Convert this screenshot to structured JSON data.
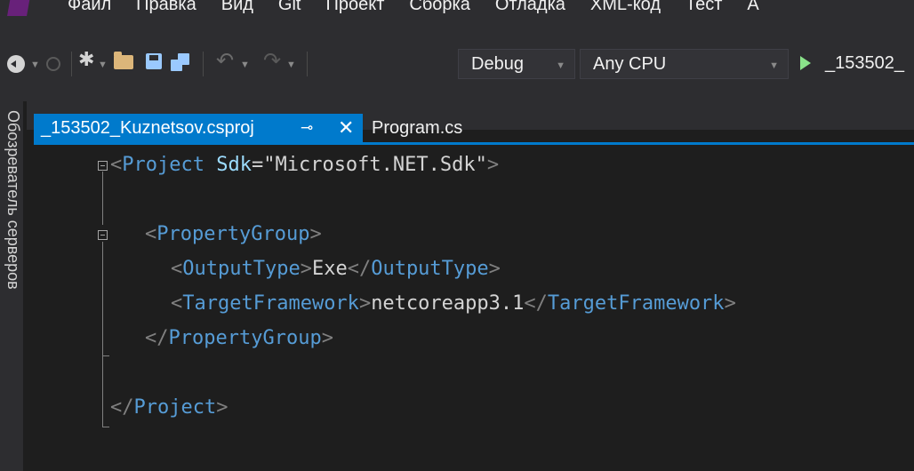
{
  "menu": {
    "items": [
      "Файл",
      "Правка",
      "Вид",
      "Git",
      "Проект",
      "Сборка",
      "Отладка",
      "XML-код",
      "Тест",
      "А"
    ]
  },
  "toolbar": {
    "configuration": "Debug",
    "platform": "Any CPU",
    "start_target": "_153502_"
  },
  "side_panel": {
    "label": "Обозреватель серверов"
  },
  "tabs": [
    {
      "label": "_153502_Kuznetsov.csproj",
      "active": true
    },
    {
      "label": "Program.cs",
      "active": false
    }
  ],
  "code": {
    "line1": {
      "open": "<",
      "tag": "Project",
      "sp": " ",
      "attr": "Sdk",
      "eq": "=",
      "val": "\"Microsoft.NET.Sdk\"",
      "close": ">"
    },
    "line3": {
      "open": "<",
      "tag": "PropertyGroup",
      "close": ">"
    },
    "line4": {
      "open": "<",
      "tag": "OutputType",
      "close": ">",
      "text": "Exe",
      "open2": "</",
      "tag2": "OutputType",
      "close2": ">"
    },
    "line5": {
      "open": "<",
      "tag": "TargetFramework",
      "close": ">",
      "text": "netcoreapp3.1",
      "open2": "</",
      "tag2": "TargetFramework",
      "close2": ">"
    },
    "line6": {
      "open": "</",
      "tag": "PropertyGroup",
      "close": ">"
    },
    "line8": {
      "open": "</",
      "tag": "Project",
      "close": ">"
    }
  },
  "colors": {
    "accent": "#007acc",
    "editor_bg": "#1e1e1e",
    "chrome_bg": "#2d2d30",
    "xml_tag": "#569cd6",
    "xml_attr": "#9cdcfe",
    "xml_punct": "#808080",
    "xml_text": "#d4d4d4"
  },
  "icons": [
    "back-icon",
    "forward-icon",
    "new-project-icon",
    "open-folder-icon",
    "save-icon",
    "save-all-icon",
    "undo-icon",
    "redo-icon",
    "start-play-icon",
    "pin-icon",
    "close-icon",
    "collapse-icon"
  ]
}
